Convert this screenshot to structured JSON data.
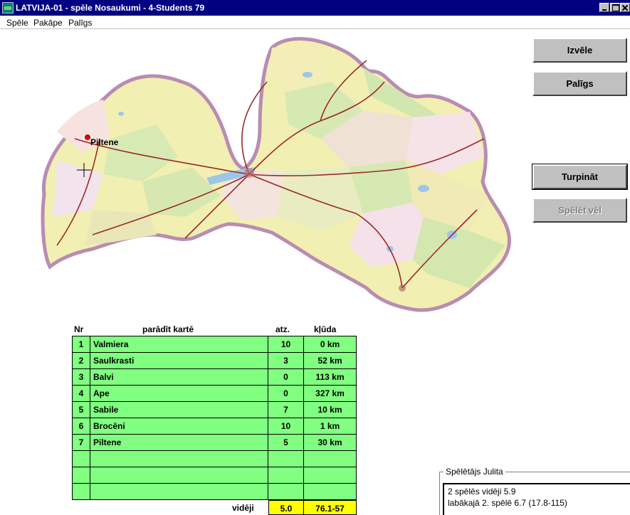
{
  "window": {
    "title": "LATVIJA-01 - spēle Nosaukumi - 4-Students 79"
  },
  "menu": {
    "items": [
      "Spēle",
      "Pakāpe",
      "Palīgs"
    ]
  },
  "map": {
    "marker_label": "Piltene"
  },
  "buttons": {
    "choose": "Izvēle",
    "help": "Palīgs",
    "continue": "Turpināt",
    "play_again": "Spēlēt vēl"
  },
  "table": {
    "headers": {
      "nr": "Nr",
      "name": "parādīt kartē",
      "score": "atz.",
      "error": "kļūda"
    },
    "rows": [
      {
        "nr": "1",
        "name": "Valmiera",
        "score": "10",
        "error": "0 km"
      },
      {
        "nr": "2",
        "name": "Saulkrasti",
        "score": "3",
        "error": "52 km"
      },
      {
        "nr": "3",
        "name": "Balvi",
        "score": "0",
        "error": "113 km"
      },
      {
        "nr": "4",
        "name": "Ape",
        "score": "0",
        "error": "327 km"
      },
      {
        "nr": "5",
        "name": "Sabile",
        "score": "7",
        "error": "10 km"
      },
      {
        "nr": "6",
        "name": "Brocēni",
        "score": "10",
        "error": "1 km"
      },
      {
        "nr": "7",
        "name": "Piltene",
        "score": "5",
        "error": "30 km"
      },
      {
        "nr": "",
        "name": "",
        "score": "",
        "error": ""
      },
      {
        "nr": "",
        "name": "",
        "score": "",
        "error": ""
      },
      {
        "nr": "",
        "name": "",
        "score": "",
        "error": ""
      }
    ],
    "average": {
      "label": "vidēji",
      "score": "5.0",
      "error": "76.1-57"
    }
  },
  "player": {
    "legend": "Spēlētājs Julita",
    "line1": "2 spēlēs vidēji  5.9",
    "line2": "labākajā 2. spēlē  6.7 (17.8-115)"
  },
  "colors": {
    "titlebar": "#000080",
    "table_cell": "#80ff80",
    "average_cell": "#ffff00",
    "face": "#c0c0c0"
  }
}
